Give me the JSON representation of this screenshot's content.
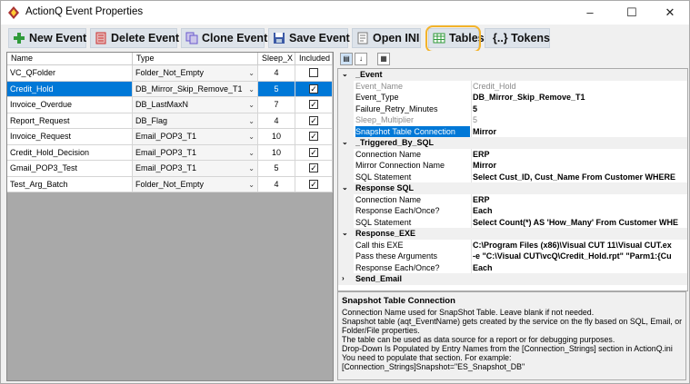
{
  "window": {
    "title": "ActionQ Event Properties",
    "minimize": "–",
    "maximize": "☐",
    "close": "✕"
  },
  "toolbar": {
    "new_event": "New Event",
    "delete_event": "Delete Event",
    "clone_event": "Clone Event",
    "save_event": "Save Event",
    "open_ini": "Open INI",
    "tables": "Tables",
    "tokens": "{..} Tokens"
  },
  "grid": {
    "headers": [
      "Name",
      "Type",
      "Sleep_X",
      "Included"
    ],
    "rows": [
      {
        "name": "VC_QFolder",
        "type": "Folder_Not_Empty",
        "sleep": "4",
        "included": false
      },
      {
        "name": "Credit_Hold",
        "type": "DB_Mirror_Skip_Remove_T1",
        "sleep": "5",
        "included": true,
        "selected": true
      },
      {
        "name": "Invoice_Overdue",
        "type": "DB_LastMaxN",
        "sleep": "7",
        "included": true
      },
      {
        "name": "Report_Request",
        "type": "DB_Flag",
        "sleep": "4",
        "included": true
      },
      {
        "name": "Invoice_Request",
        "type": "Email_POP3_T1",
        "sleep": "10",
        "included": true
      },
      {
        "name": "Credit_Hold_Decision",
        "type": "Email_POP3_T1",
        "sleep": "10",
        "included": true
      },
      {
        "name": "Gmail_POP3_Test",
        "type": "Email_POP3_T1",
        "sleep": "5",
        "included": true
      },
      {
        "name": "Test_Arg_Batch",
        "type": "Folder_Not_Empty",
        "sleep": "4",
        "included": true
      }
    ]
  },
  "properties": {
    "rows": [
      {
        "kind": "cat",
        "expander": "⌄",
        "label": "_Event"
      },
      {
        "kind": "ro",
        "label": "Event_Name",
        "value": "Credit_Hold"
      },
      {
        "kind": "prop",
        "label": "Event_Type",
        "value": "DB_Mirror_Skip_Remove_T1"
      },
      {
        "kind": "prop",
        "label": "Failure_Retry_Minutes",
        "value": "5"
      },
      {
        "kind": "ro",
        "label": "Sleep_Multiplier",
        "value": "5"
      },
      {
        "kind": "hl",
        "label": "Snapshot Table Connection",
        "value": "Mirror"
      },
      {
        "kind": "cat",
        "expander": "⌄",
        "label": "_Triggered_By_SQL"
      },
      {
        "kind": "prop",
        "label": "Connection Name",
        "value": "ERP"
      },
      {
        "kind": "prop",
        "label": "Mirror Connection Name",
        "value": "Mirror"
      },
      {
        "kind": "prop",
        "label": "SQL Statement",
        "value": "Select Cust_ID, Cust_Name From Customer WHERE"
      },
      {
        "kind": "cat",
        "expander": "⌄",
        "label": "Response SQL"
      },
      {
        "kind": "prop",
        "label": "Connection Name",
        "value": "ERP"
      },
      {
        "kind": "prop",
        "label": "Response Each/Once?",
        "value": "Each"
      },
      {
        "kind": "prop",
        "label": "SQL Statement",
        "value": "Select Count(*) AS 'How_Many' From Customer WHE"
      },
      {
        "kind": "cat",
        "expander": "⌄",
        "label": "Response_EXE"
      },
      {
        "kind": "prop",
        "label": "Call this EXE",
        "value": "C:\\Program Files (x86)\\Visual CUT 11\\Visual CUT.ex"
      },
      {
        "kind": "prop",
        "label": "Pass these Arguments",
        "value": "-e \"C:\\Visual CUT\\vcQ\\Credit_Hold.rpt\" \"Parm1:{Cu"
      },
      {
        "kind": "prop",
        "label": "Response Each/Once?",
        "value": "Each"
      },
      {
        "kind": "cat",
        "expander": "›",
        "label": "Send_Email"
      }
    ]
  },
  "description": {
    "title": "Snapshot Table Connection",
    "lines": [
      "Connection Name used for SnapShot Table. Leave blank if not needed.",
      "Snapshot table (aqt_EventName) gets created by the service on the fly based on SQL, Email, or",
      "Folder/File properties.",
      "The table can be used as data source for a report or for debugging purposes.",
      "Drop-Down Is Populated by Entry Names from the [Connection_Strings] section in ActionQ.ini",
      "You need to populate that section. For example:",
      "[Connection_Strings]Snapshot=\"ES_Snapshot_DB\""
    ]
  },
  "colors": {
    "selection": "#0078d7",
    "highlight_ring": "#f3b32a",
    "toolbar_button": "#dde3ea"
  },
  "icons": [
    "app-icon",
    "plus-icon",
    "delete-icon",
    "clone-icon",
    "save-icon",
    "ini-icon",
    "table-icon",
    "categorized-icon",
    "alphabetical-icon",
    "property-pages-icon"
  ]
}
